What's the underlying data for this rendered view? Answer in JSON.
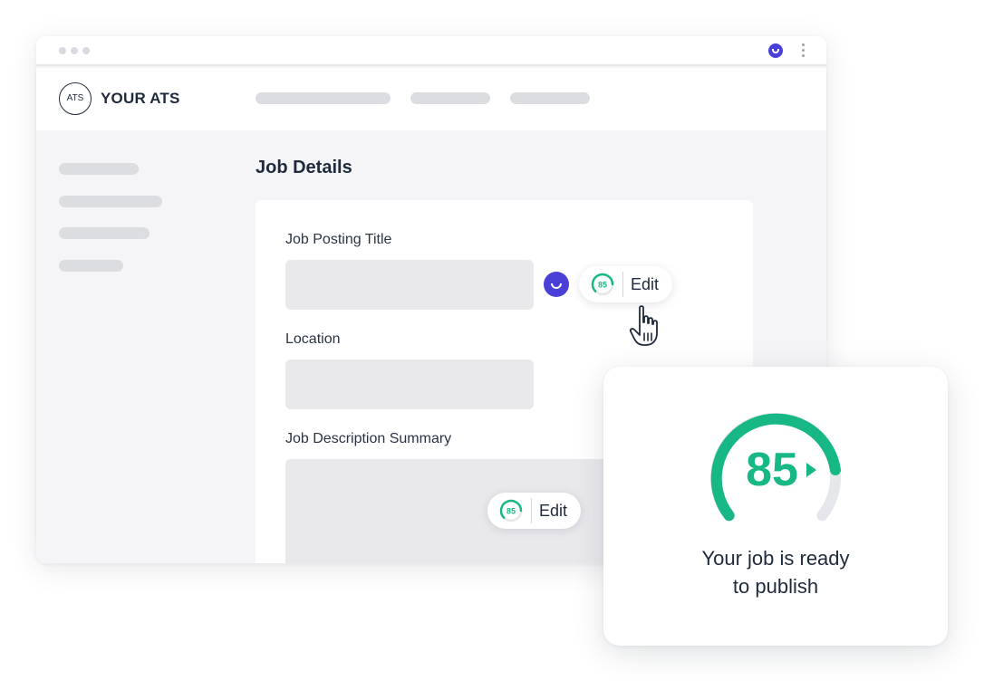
{
  "header": {
    "logo_mark": "ATS",
    "app_name": "YOUR ATS"
  },
  "page": {
    "title": "Job Details"
  },
  "form": {
    "fields": [
      {
        "label": "Job Posting Title",
        "value": ""
      },
      {
        "label": "Location",
        "value": ""
      },
      {
        "label": "Job Description Summary",
        "value": ""
      }
    ]
  },
  "edit_chips": [
    {
      "score": "85",
      "label": "Edit"
    },
    {
      "score": "85",
      "label": "Edit"
    }
  ],
  "score_card": {
    "score": "85",
    "score_fraction": 0.85,
    "message_line1": "Your job is ready",
    "message_line2": "to publish"
  },
  "colors": {
    "accent_green": "#17b786",
    "track_gray": "#e6e7ea",
    "avatar_purple": "#4a3fd6",
    "text_dark": "#1f2a3d"
  },
  "icons": [
    "cursor-hand-icon",
    "user-avatar-icon",
    "kebab-menu-icon",
    "score-gauge-icon"
  ]
}
